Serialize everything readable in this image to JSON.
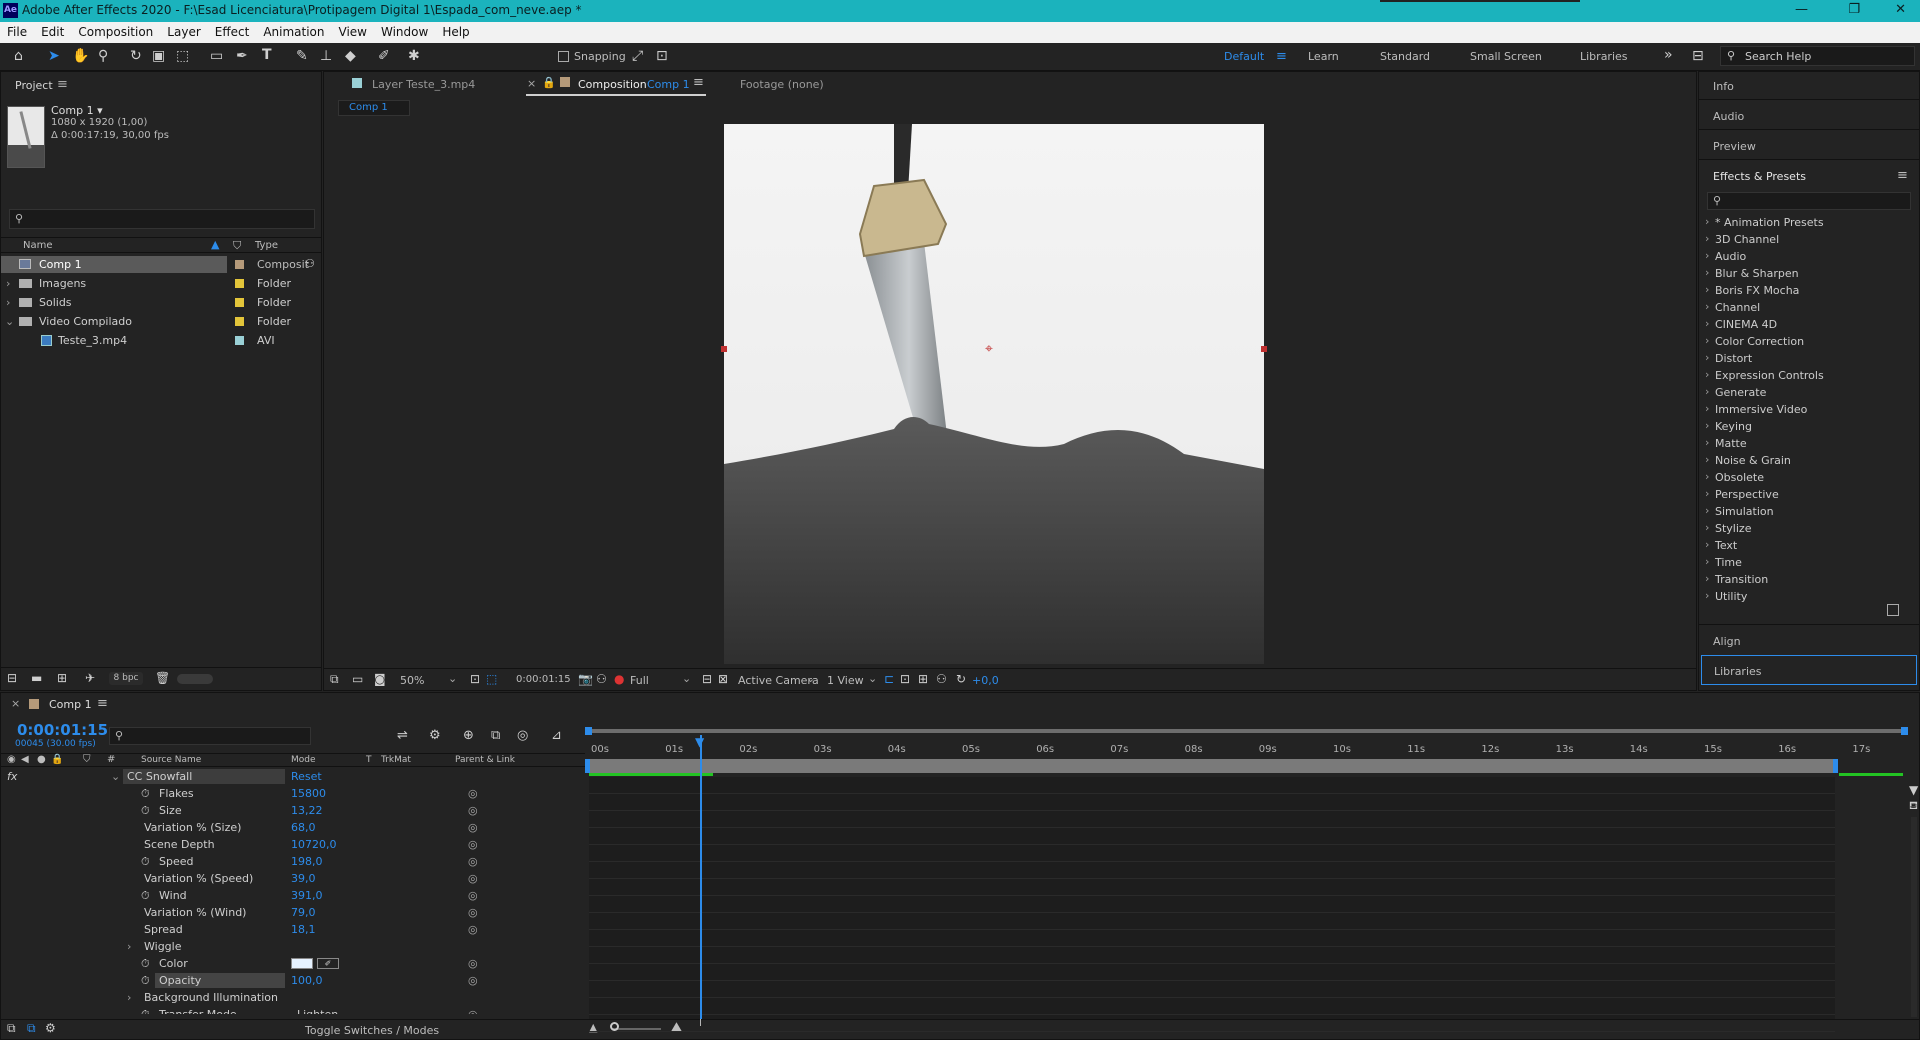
{
  "window": {
    "title": "Adobe After Effects 2020 - F:\\Esad Licenciatura\\Protipagem Digital 1\\Espada_com_neve.aep *",
    "app_icon": "Ae",
    "controls": [
      "—",
      "❐",
      "✕"
    ]
  },
  "menu": [
    "File",
    "Edit",
    "Composition",
    "Layer",
    "Effect",
    "Animation",
    "View",
    "Window",
    "Help"
  ],
  "toolbar": {
    "snapping": "Snapping",
    "workspaces": [
      "Default",
      "Learn",
      "Standard",
      "Small Screen",
      "Libraries"
    ],
    "search_placeholder": "Search Help"
  },
  "project": {
    "title": "Project",
    "comp_name": "Comp 1 ▾",
    "comp_size": "1080 x 1920 (1,00)",
    "comp_duration": "Δ 0:00:17:19, 30,00 fps",
    "search_placeholder": "",
    "col_name": "Name",
    "col_type": "Type",
    "bpc": "8 bpc",
    "items": [
      {
        "name": "Comp 1",
        "type": "Composit",
        "color": "#b59a7a",
        "icon": "comp-icon"
      },
      {
        "name": "Imagens",
        "type": "Folder",
        "color": "#e3c53a",
        "icon": "folder-icon"
      },
      {
        "name": "Solids",
        "type": "Folder",
        "color": "#e3c53a",
        "icon": "folder-icon"
      },
      {
        "name": "Video Compilado",
        "type": "Folder",
        "color": "#e3c53a",
        "icon": "folder-icon"
      },
      {
        "name": "Teste_3.mp4",
        "type": "AVI",
        "color": "#9ad0d6",
        "icon": "footage-icon"
      }
    ]
  },
  "viewer": {
    "tab_layer": "Layer  Teste_3.mp4",
    "tab_comp_label": "Composition",
    "tab_comp_name": "Comp 1",
    "tab_footage": "Footage (none)",
    "crumb": "Comp 1",
    "zoom": "50%",
    "timecode": "0:00:01:15",
    "resolution": "Full",
    "camera": "Active Camera",
    "views": "1 View",
    "exposure": "+0,0"
  },
  "right_panel": {
    "info": "Info",
    "audio": "Audio",
    "preview": "Preview",
    "effects_title": "Effects & Presets",
    "align": "Align",
    "libraries": "Libraries",
    "effects": [
      "* Animation Presets",
      "3D Channel",
      "Audio",
      "Blur & Sharpen",
      "Boris FX Mocha",
      "Channel",
      "CINEMA 4D",
      "Color Correction",
      "Distort",
      "Expression Controls",
      "Generate",
      "Immersive Video",
      "Keying",
      "Matte",
      "Noise & Grain",
      "Obsolete",
      "Perspective",
      "Simulation",
      "Stylize",
      "Text",
      "Time",
      "Transition",
      "Utility"
    ]
  },
  "timeline": {
    "tab": "Comp 1",
    "timecode": "0:00:01:15",
    "frame_info": "00045 (30.00 fps)",
    "col_source": "Source Name",
    "col_mode": "Mode",
    "col_t": "T",
    "col_trkmat": "TrkMat",
    "col_parent": "Parent & Link",
    "toggle": "Toggle Switches / Modes",
    "effect_name": "CC Snowfall",
    "reset": "Reset",
    "props": [
      {
        "name": "Flakes",
        "value": "15800",
        "sw": true
      },
      {
        "name": "Size",
        "value": "13,22",
        "sw": true
      },
      {
        "name": "Variation % (Size)",
        "value": "68,0",
        "sw": false
      },
      {
        "name": "Scene Depth",
        "value": "10720,0",
        "sw": false
      },
      {
        "name": "Speed",
        "value": "198,0",
        "sw": true
      },
      {
        "name": "Variation % (Speed)",
        "value": "39,0",
        "sw": false
      },
      {
        "name": "Wind",
        "value": "391,0",
        "sw": true
      },
      {
        "name": "Variation % (Wind)",
        "value": "79,0",
        "sw": false
      },
      {
        "name": "Spread",
        "value": "18,1",
        "sw": false
      },
      {
        "name": "Wiggle",
        "value": "",
        "sw": false
      },
      {
        "name": "Color",
        "value": "",
        "sw": true
      },
      {
        "name": "Opacity",
        "value": "100,0",
        "sw": true
      },
      {
        "name": "Background Illumination",
        "value": "",
        "sw": false
      },
      {
        "name": "Transfer Mode",
        "value": "Lighten",
        "sw": true
      }
    ],
    "ruler": [
      "00s",
      "01s",
      "02s",
      "03s",
      "04s",
      "05s",
      "06s",
      "07s",
      "08s",
      "09s",
      "10s",
      "11s",
      "12s",
      "13s",
      "14s",
      "15s",
      "16s",
      "17s"
    ]
  }
}
